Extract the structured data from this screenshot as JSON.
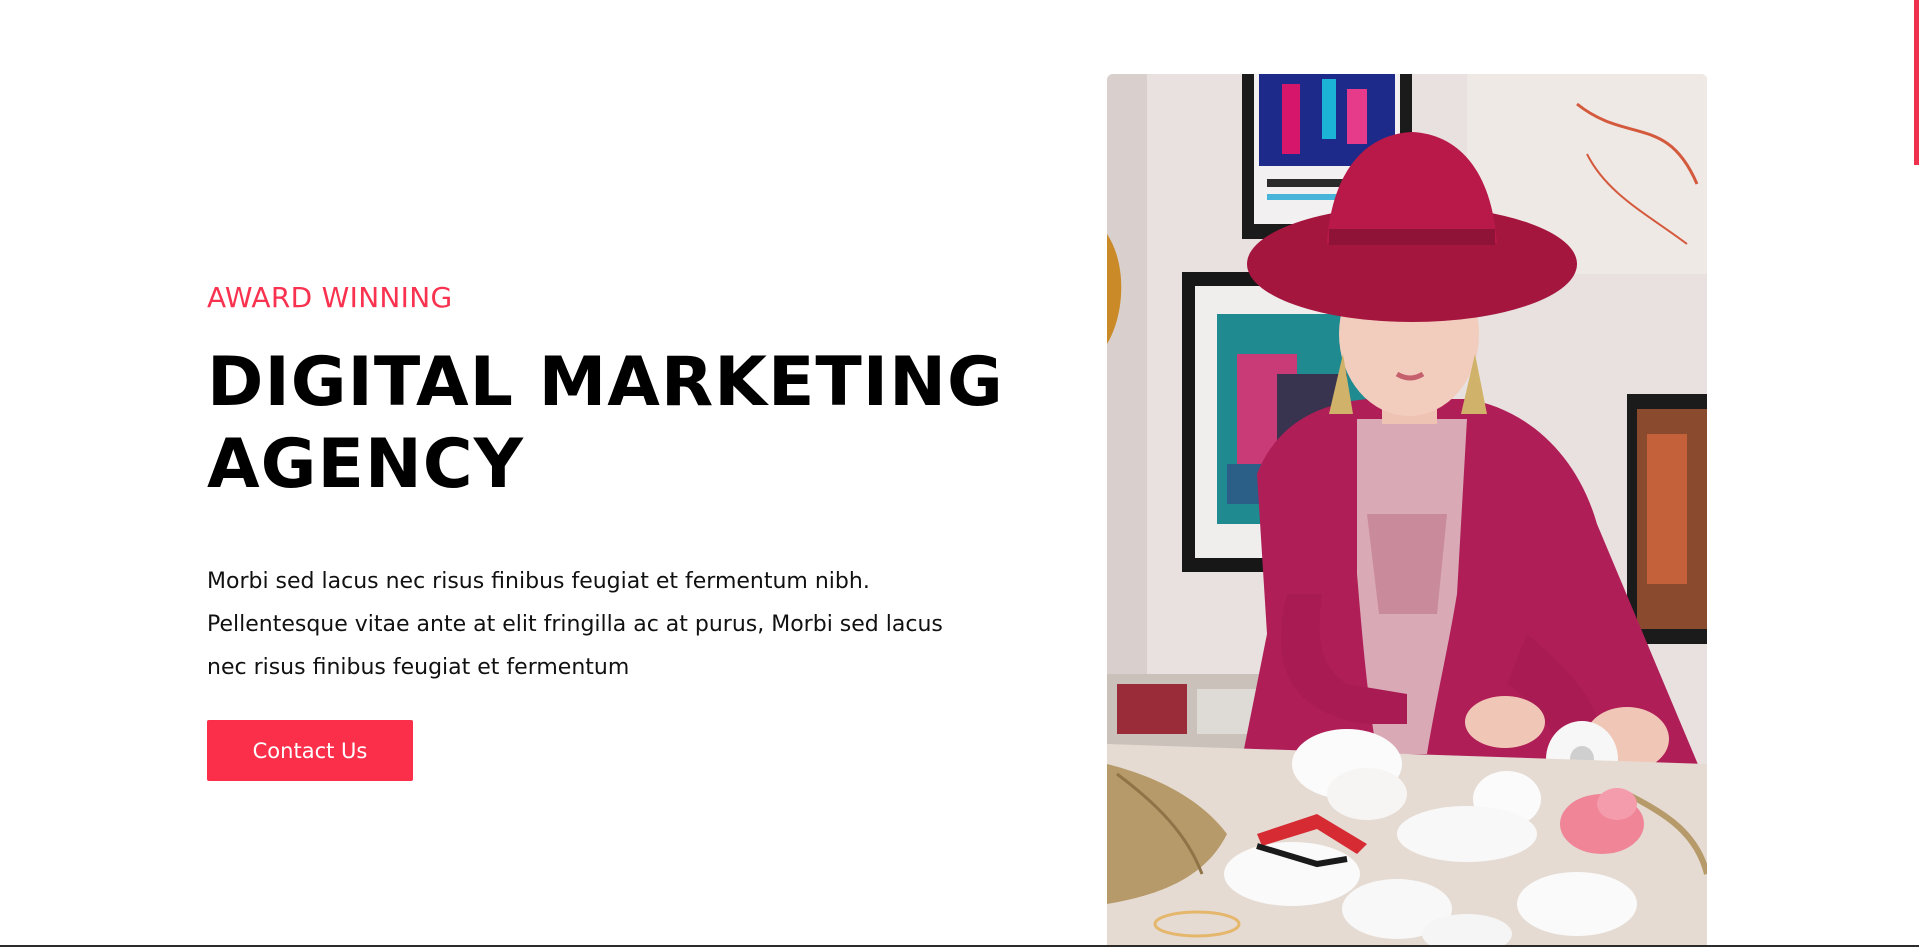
{
  "hero": {
    "eyebrow": "AWARD WINNING",
    "title_line1": "DIGITAL MARKETING",
    "title_line2": "AGENCY",
    "body_line1": "Morbi sed lacus nec risus finibus feugiat et fermentum nibh.",
    "body_line2": "Pellentesque vitae ante at elit fringilla ac at purus, Morbi sed lacus",
    "body_line3": "nec risus finibus feugiat et fermentum",
    "cta_label": "Contact Us"
  },
  "colors": {
    "accent": "#fc2f4b",
    "eyebrow": "#f8324f",
    "text": "#000000",
    "background": "#ffffff"
  },
  "image": {
    "description_icon": "photo-woman-crafting"
  }
}
